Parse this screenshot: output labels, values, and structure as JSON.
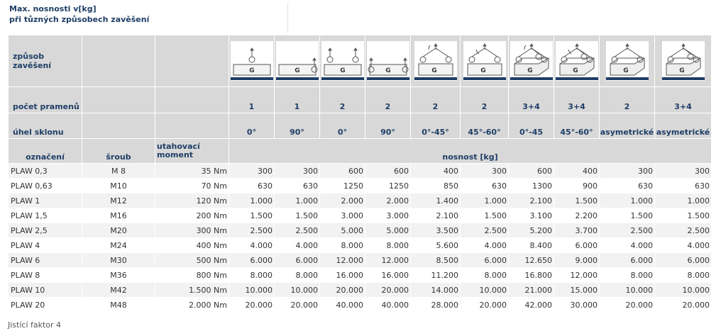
{
  "title": {
    "line1": "Max. nosnosti v[kg]",
    "line2": "při tůzných způsobech zavěšení"
  },
  "labels": {
    "method": "způsob zavěšení",
    "strands": "počet pramenů",
    "angle": "úhel sklonu",
    "designation": "označení",
    "bolt": "šroub",
    "torque": "utahovací moment",
    "capacity": "nosnost [kg]"
  },
  "strands": [
    "1",
    "1",
    "2",
    "2",
    "2",
    "2",
    "3+4",
    "3+4",
    "2",
    "3+4"
  ],
  "angles": [
    "0°",
    "90°",
    "0°",
    "90°",
    "0°-45°",
    "45°-60°",
    "0°-45",
    "45°-60°",
    "asymetrické",
    "asymetrické"
  ],
  "icons": [
    "single-vertical-hook-icon",
    "single-side-hook-icon",
    "double-vertical-hooks-icon",
    "double-side-hooks-icon",
    "two-leg-sling-0-45-icon",
    "two-leg-sling-45-60-icon",
    "multi-leg-sling-0-45-icon",
    "multi-leg-sling-45-60-icon",
    "two-leg-asymmetric-sling-icon",
    "multi-leg-asymmetric-sling-icon"
  ],
  "rows": [
    {
      "name": "PLAW 0,3",
      "bolt": "M 8",
      "torque": "35 Nm",
      "values": [
        "300",
        "300",
        "600",
        "600",
        "400",
        "300",
        "600",
        "400",
        "300",
        "300"
      ]
    },
    {
      "name": "PLAW 0,63",
      "bolt": "M10",
      "torque": "70 Nm",
      "values": [
        "630",
        "630",
        "1250",
        "1250",
        "850",
        "630",
        "1300",
        "900",
        "630",
        "630"
      ]
    },
    {
      "name": "PLAW 1",
      "bolt": "M12",
      "torque": "120 Nm",
      "values": [
        "1.000",
        "1.000",
        "2.000",
        "2.000",
        "1.400",
        "1.000",
        "2.100",
        "1.500",
        "1.000",
        "1.000"
      ]
    },
    {
      "name": "PLAW 1,5",
      "bolt": "M16",
      "torque": "200 Nm",
      "values": [
        "1.500",
        "1.500",
        "3.000",
        "3.000",
        "2.100",
        "1.500",
        "3.100",
        "2.200",
        "1.500",
        "1.500"
      ]
    },
    {
      "name": "PLAW 2,5",
      "bolt": "M20",
      "torque": "300 Nm",
      "values": [
        "2.500",
        "2.500",
        "5.000",
        "5.000",
        "3.500",
        "2.500",
        "5.200",
        "3.700",
        "2.500",
        "2.500"
      ]
    },
    {
      "name": "PLAW 4",
      "bolt": "M24",
      "torque": "400 Nm",
      "values": [
        "4.000",
        "4.000",
        "8.000",
        "8.000",
        "5.600",
        "4.000",
        "8.400",
        "6.000",
        "4.000",
        "4.000"
      ]
    },
    {
      "name": "PLAW 6",
      "bolt": "M30",
      "torque": "500 Nm",
      "values": [
        "6.000",
        "6.000",
        "12.000",
        "12.000",
        "8.500",
        "6.000",
        "12.650",
        "9.000",
        "6.000",
        "6.000"
      ]
    },
    {
      "name": "PLAW 8",
      "bolt": "M36",
      "torque": "800 Nm",
      "values": [
        "8.000",
        "8.000",
        "16.000",
        "16.000",
        "11.200",
        "8.000",
        "16.800",
        "12.000",
        "8.000",
        "8.000"
      ]
    },
    {
      "name": "PLAW 10",
      "bolt": "M42",
      "torque": "1.500 Nm",
      "values": [
        "10.000",
        "10.000",
        "20.000",
        "20.000",
        "14.000",
        "10.000",
        "21.000",
        "15.000",
        "10.000",
        "10.000"
      ]
    },
    {
      "name": "PLAW 20",
      "bolt": "M48",
      "torque": "2.000 Nm",
      "values": [
        "20.000",
        "20.000",
        "40.000",
        "40.000",
        "28.000",
        "20.000",
        "42.000",
        "30.000",
        "20.000",
        "20.000"
      ]
    }
  ],
  "load_letter": "G",
  "footnote": "Jistící faktor 4"
}
